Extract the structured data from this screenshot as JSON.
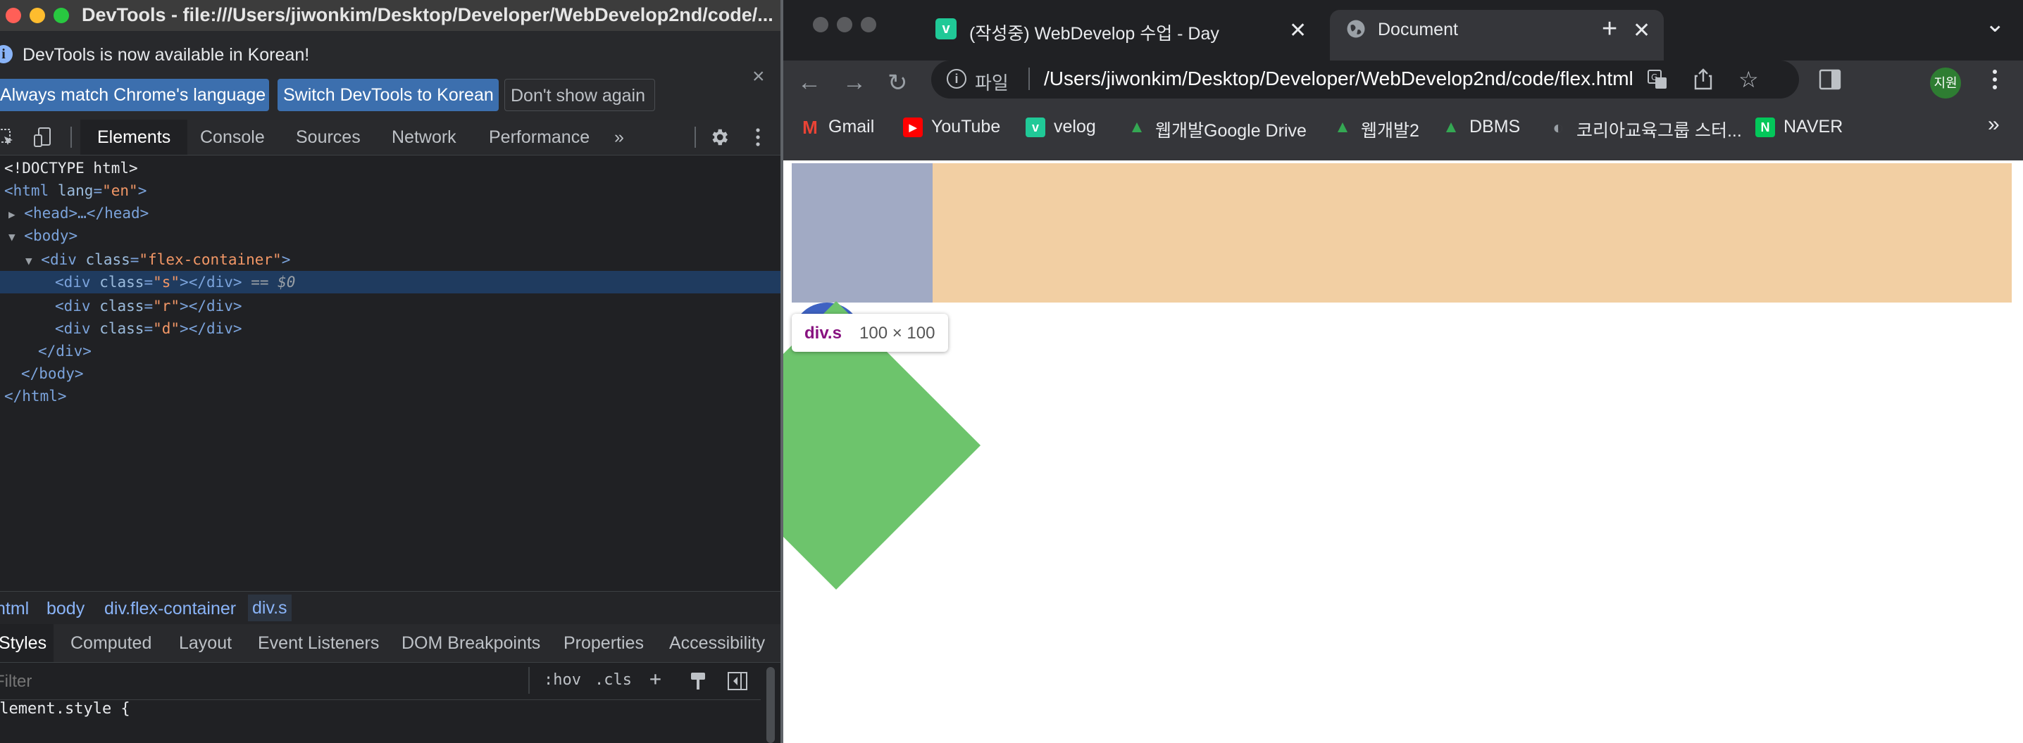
{
  "devtools": {
    "window_title": "DevTools - file:///Users/jiwonkim/Desktop/Developer/WebDevelop2nd/code/...",
    "infobar": {
      "message": "DevTools is now available in Korean!",
      "match_language": "Always match Chrome's language",
      "switch_korean": "Switch DevTools to Korean",
      "dont_show": "Don't show again",
      "close": "×"
    },
    "tabs": [
      "Elements",
      "Console",
      "Sources",
      "Network",
      "Performance"
    ],
    "tabs_more": "»",
    "elements": {
      "doctype": "<!DOCTYPE html>",
      "html_open_tag": "<html",
      "lang_attr": "lang",
      "lang_val": "\"en\"",
      "head_collapsed": "<head>…</head>",
      "body_open": "<body>",
      "div_open": "<div",
      "class_attr": "class",
      "container_class": "\"flex-container\"",
      "s_class": "\"s\"",
      "r_class": "\"r\"",
      "d_class": "\"d\"",
      "div_close_inline": "></div>",
      "tag_end": ">",
      "selected_marker": "== $0",
      "div_close": "</div>",
      "body_close": "</body>",
      "html_close": "</html>"
    },
    "breadcrumbs": [
      "html",
      "body",
      "div.flex-container",
      "div.s"
    ],
    "styles_tabs": [
      "Styles",
      "Computed",
      "Layout",
      "Event Listeners",
      "DOM Breakpoints",
      "Properties",
      "Accessibility"
    ],
    "filter_placeholder": "Filter",
    "hov": ":hov",
    "cls": ".cls",
    "plus": "+",
    "element_style": "element.style {"
  },
  "browser": {
    "tabs": [
      {
        "title": "(작성중) WebDevelop 수업 - Day",
        "favicon": "v"
      },
      {
        "title": "Document",
        "favicon": "globe-icon"
      }
    ],
    "new_tab": "+",
    "tab_search": "⌄",
    "url_scheme": "파일",
    "url": "/Users/jiwonkim/Desktop/Developer/WebDevelop2nd/code/flex.html",
    "avatar": "지원",
    "bookmarks": [
      {
        "label": "Gmail",
        "icon": "M",
        "color": "#ea4335"
      },
      {
        "label": "YouTube",
        "icon": "▶",
        "color": "#ff0000"
      },
      {
        "label": "velog",
        "icon": "v",
        "color": "#20c997"
      },
      {
        "label": "웹개발Google Drive",
        "icon": "▲",
        "color": "#34a853"
      },
      {
        "label": "웹개발2",
        "icon": "▲",
        "color": "#34a853"
      },
      {
        "label": "DBMS",
        "icon": "▲",
        "color": "#34a853"
      },
      {
        "label": "코리아교육그룹 스터...",
        "icon": "◐",
        "color": "#7a7a7a"
      },
      {
        "label": "NAVER",
        "icon": "N",
        "color": "#03c75a"
      }
    ],
    "bookmarks_more": "»",
    "inspect_tooltip": {
      "name": "div.s",
      "size": "100 × 100"
    },
    "colors": {
      "container": "#f2cfa3",
      "box_s": "#a1aac4",
      "box_r": "#3e62c2",
      "box_d": "#6dc46c"
    }
  }
}
